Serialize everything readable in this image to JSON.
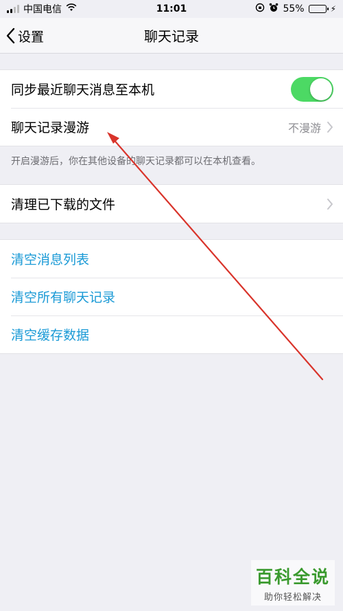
{
  "status_bar": {
    "carrier": "中国电信",
    "time": "11:01",
    "battery_percent": "55%",
    "battery_level": 0.55,
    "icons": [
      "signal-icon",
      "wifi-icon",
      "rotation-lock-icon",
      "alarm-icon",
      "battery-icon",
      "charging-bolt-icon"
    ]
  },
  "nav": {
    "back_label": "设置",
    "title": "聊天记录"
  },
  "group1": {
    "sync_label": "同步最近聊天消息至本机",
    "sync_enabled": true,
    "roaming_label": "聊天记录漫游",
    "roaming_value": "不漫游",
    "footnote": "开启漫游后，你在其他设备的聊天记录都可以在本机查看。"
  },
  "group2": {
    "clear_downloads_label": "清理已下载的文件"
  },
  "group3": {
    "clear_message_list": "清空消息列表",
    "clear_all_chats": "清空所有聊天记录",
    "clear_cache": "清空缓存数据"
  },
  "colors": {
    "accent_link": "#1a9ad6",
    "toggle_on": "#4cd964",
    "annotation_arrow": "#d9342b",
    "watermark_green": "#3a9a2e"
  },
  "watermark": {
    "title": "百科全说",
    "subtitle": "助你轻松解决"
  }
}
